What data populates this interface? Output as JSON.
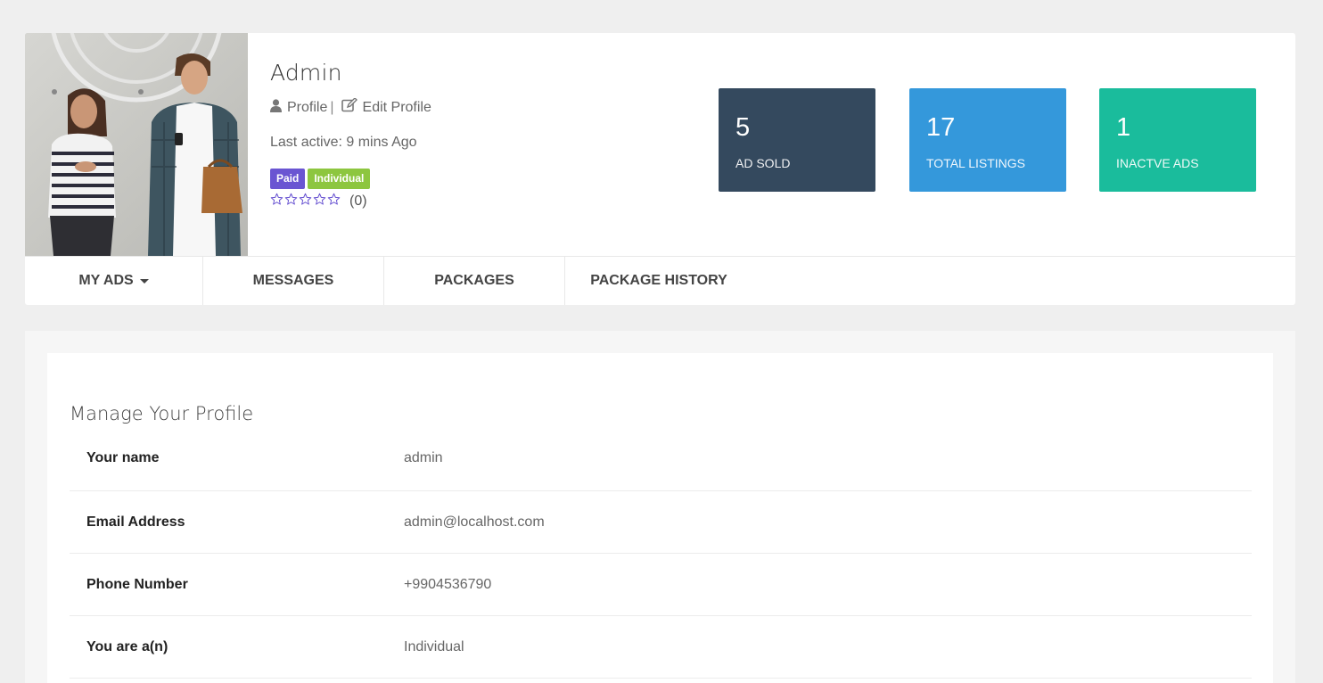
{
  "profile": {
    "name": "Admin",
    "profile_link": "Profile",
    "separator": "|",
    "edit_link": "Edit Profile",
    "last_active": "Last active: 9 mins Ago",
    "badges": [
      "Paid",
      "Individual"
    ],
    "rating": {
      "stars": 0,
      "max": 5,
      "count_label": "(0)"
    }
  },
  "stats": [
    {
      "value": "5",
      "label": "AD SOLD",
      "color": "#34495e"
    },
    {
      "value": "17",
      "label": "TOTAL LISTINGS",
      "color": "#3498db"
    },
    {
      "value": "1",
      "label": "INACTVE ADS",
      "color": "#1abc9c"
    }
  ],
  "tabs": [
    {
      "label": "MY ADS",
      "has_dropdown": true
    },
    {
      "label": "MESSAGES"
    },
    {
      "label": "PACKAGES"
    },
    {
      "label": "PACKAGE HISTORY"
    }
  ],
  "manage": {
    "title": "Manage Your Profile",
    "rows": [
      {
        "label": "Your name",
        "value": "admin"
      },
      {
        "label": "Email Address",
        "value": "admin@localhost.com"
      },
      {
        "label": "Phone Number",
        "value": "+9904536790"
      },
      {
        "label": "You are a(n)",
        "value": "Individual"
      }
    ]
  },
  "colors": {
    "badge_paid": "#6a55d2",
    "badge_individual": "#8dc63f",
    "star_outline": "#6a55d2"
  },
  "icons": [
    "user-icon",
    "edit-icon",
    "star-icon",
    "caret-down-icon"
  ]
}
